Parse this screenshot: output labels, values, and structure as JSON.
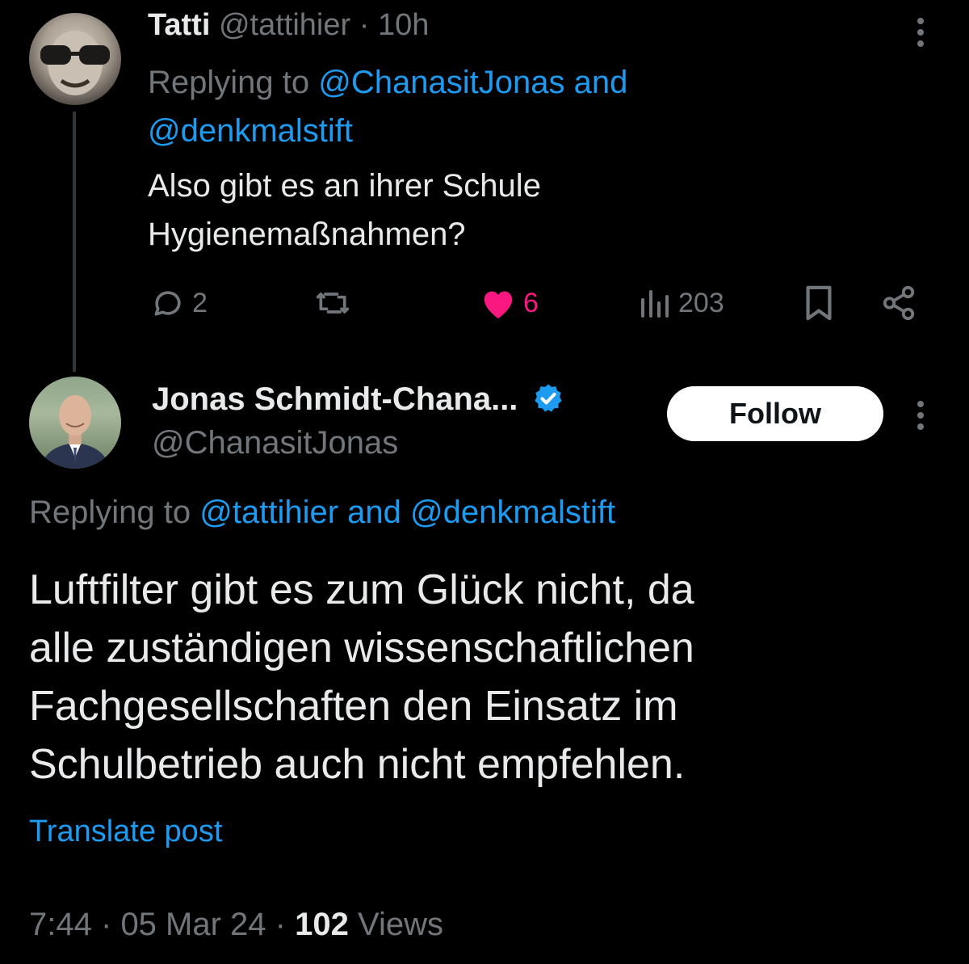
{
  "reply_tweet": {
    "display_name": "Tatti",
    "handle": "@tattihier",
    "time_sep": "·",
    "time": "10h",
    "replying_prefix": "Replying to",
    "replying_to_1": "@ChanasitJonas",
    "replying_and": "and",
    "replying_to_2": "@denkmalstift",
    "text_line1": "Also gibt es an ihrer Schule",
    "text_line2": "Hygienemaßnahmen?",
    "replies": "2",
    "likes": "6",
    "views": "203"
  },
  "main_tweet": {
    "display_name": "Jonas Schmidt-Chana...",
    "handle": "@ChanasitJonas",
    "follow_label": "Follow",
    "replying_prefix": "Replying to",
    "replying_to_1": "@tattihier",
    "replying_and": "and",
    "replying_to_2": "@denkmalstift",
    "text_lines": [
      "Luftfilter gibt es zum Glück nicht, da",
      "alle zuständigen wissenschaftlichen",
      "Fachgesellschaften den Einsatz im",
      "Schulbetrieb auch nicht empfehlen."
    ],
    "translate_label": "Translate post",
    "time": "7:44",
    "sep": "·",
    "date": "05 Mar 24",
    "views_count": "102",
    "views_label": "Views"
  },
  "colors": {
    "background": "#000000",
    "text": "#e7e9ea",
    "muted": "#71767b",
    "link": "#1d9bf0",
    "like": "#f91880",
    "verified": "#1d9bf0"
  },
  "icons": {
    "reply": "speech-bubble-icon",
    "retweet": "retweet-icon",
    "like": "heart-icon",
    "views": "bar-chart-icon",
    "bookmark": "bookmark-icon",
    "share": "share-icon",
    "more": "more-vertical-icon",
    "verified": "verified-badge-icon"
  }
}
